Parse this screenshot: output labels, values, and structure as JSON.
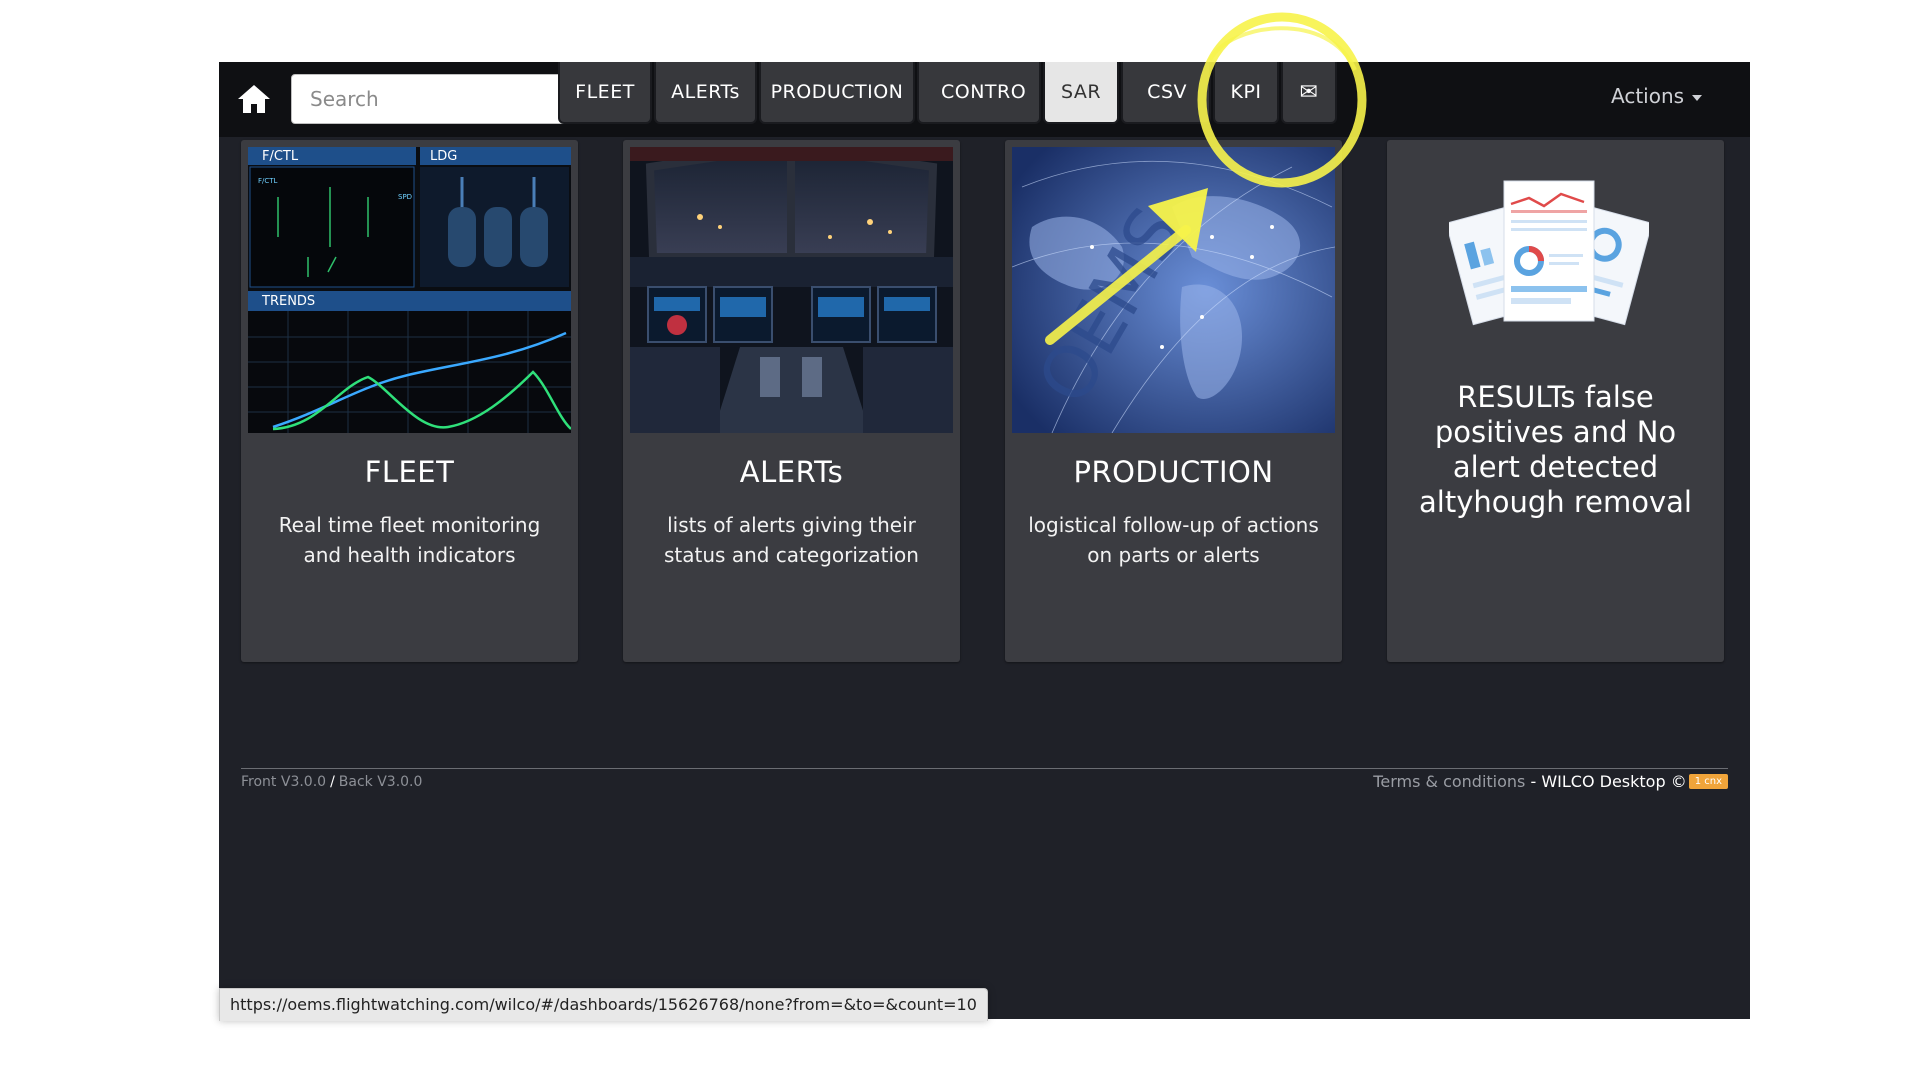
{
  "topbar": {
    "home_icon": "home-icon",
    "search": {
      "placeholder": "Search",
      "value": ""
    },
    "nav": [
      {
        "label": "FLEET",
        "active": false
      },
      {
        "label": "ALERTs",
        "active": false
      },
      {
        "label": "PRODUCTION",
        "active": false
      },
      {
        "label": "CONTRO",
        "active": false
      },
      {
        "label": "SAR",
        "active": true
      },
      {
        "label": "CSV",
        "active": false
      },
      {
        "label": "KPI",
        "active": false
      },
      {
        "label": "✉",
        "active": false,
        "icon": "mail-icon"
      }
    ],
    "actions_label": "Actions"
  },
  "cards": [
    {
      "title": "FLEET",
      "description": "Real time fleet monitoring and health indicators",
      "image": {
        "panel_left": "F/CTL",
        "panel_right": "LDG",
        "panel_bottom": "TRENDS"
      }
    },
    {
      "title": "ALERTs",
      "description": "lists of alerts giving their status and categorization",
      "image": {
        "icon": "cockpit-photo"
      }
    },
    {
      "title": "PRODUCTION",
      "description": "logistical follow-up of actions on parts or alerts",
      "image": {
        "icon": "world-map-photo",
        "overlay_text": "OEMS"
      }
    },
    {
      "text": "RESULTs false positives and No alert detected altyhough removal",
      "image": {
        "icon": "report-documents-icon"
      }
    }
  ],
  "footer": {
    "front_version": "Front V3.0.0",
    "separator": "/",
    "back_version": "Back V3.0.0",
    "terms": "Terms & conditions",
    "brand": " - WILCO Desktop ©",
    "badge": "1 cnx"
  },
  "statusbar": {
    "url": "https://oems.flightwatching.com/wilco/#/dashboards/15626768/none?from=&to=&count=10"
  },
  "colors": {
    "app_bg": "#1f2128",
    "topbar_bg": "#0f1013",
    "card_bg": "#3b3c41",
    "nav_btn_bg": "#37383c",
    "nav_active_bg": "#e6e6e6",
    "badge": "#f0a43a",
    "highlight": "#f7f34a"
  }
}
